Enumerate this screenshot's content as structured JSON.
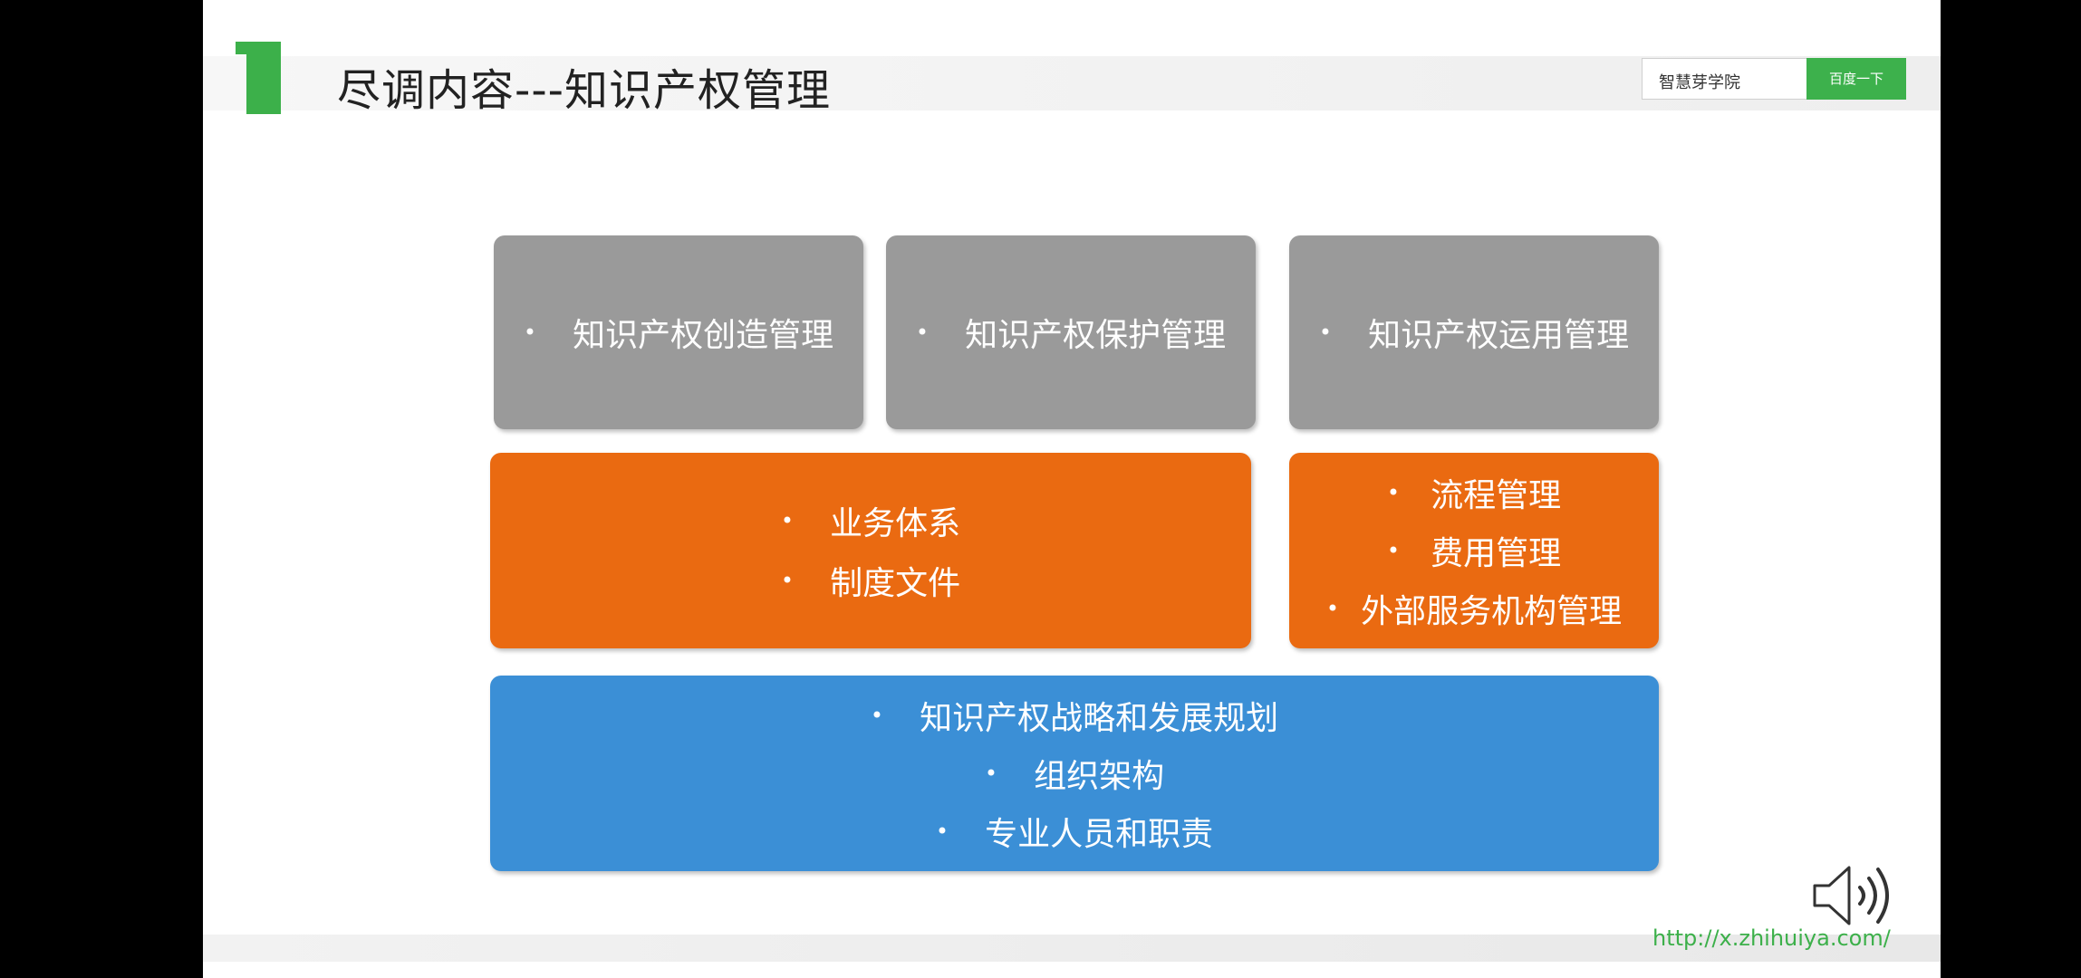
{
  "slide": {
    "number": "1",
    "title": "尽调内容---知识产权管理"
  },
  "search": {
    "query": "智慧芽学院",
    "button_label": "百度一下"
  },
  "gray_boxes": [
    {
      "text": "知识产权创造管理"
    },
    {
      "text": "知识产权保护管理"
    },
    {
      "text": "知识产权运用管理"
    }
  ],
  "orange_boxes": [
    {
      "items": [
        "业务体系",
        "制度文件"
      ]
    },
    {
      "items": [
        "流程管理",
        "费用管理",
        "外部服务机构管理"
      ]
    }
  ],
  "blue_box": {
    "items": [
      "知识产权战略和发展规划",
      "组织架构",
      "专业人员和职责"
    ]
  },
  "footer": {
    "url": "http://x.zhihuiya.com/"
  },
  "colors": {
    "accent_green": "#3cb04a",
    "gray_box": "#9a9a9a",
    "orange_box": "#ea6a11",
    "blue_box": "#3b8fd6"
  },
  "icons": {
    "slide_number": "green-numeral-icon",
    "speaker": "speaker-volume-icon",
    "clear": "close-icon"
  }
}
